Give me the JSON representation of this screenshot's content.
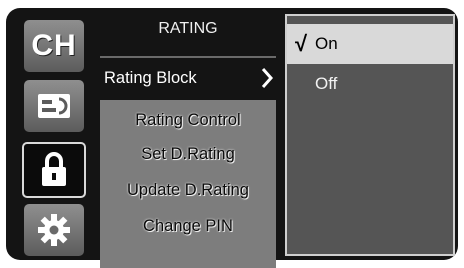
{
  "left_column": {
    "ch_label": "CH",
    "icons": [
      "channel-tile",
      "input-source-icon",
      "lock-icon",
      "gear-icon"
    ]
  },
  "menu": {
    "title": "RATING",
    "items": [
      {
        "label": "Rating Block",
        "selected": true
      },
      {
        "label": "Rating Control"
      },
      {
        "label": "Set D.Rating"
      },
      {
        "label": "Update D.Rating"
      },
      {
        "label": "Change PIN"
      }
    ]
  },
  "options": {
    "check_mark": "√",
    "items": [
      {
        "label": "On",
        "selected": true
      },
      {
        "label": "Off"
      }
    ]
  },
  "colors": {
    "background": "#141414",
    "menu_panel": "#7d7d7d",
    "option_panel": "#555555",
    "selected_option": "#d9d9d9"
  }
}
